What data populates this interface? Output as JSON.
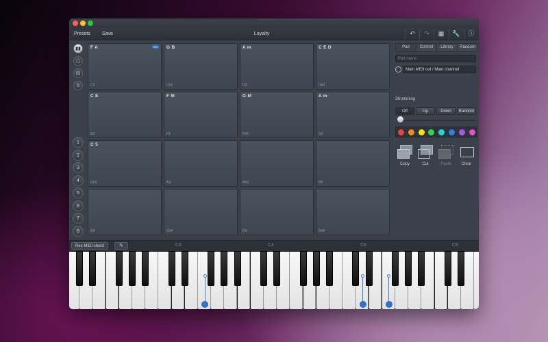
{
  "window": {
    "title": "Loyalty",
    "traffic_lights": {
      "close": "#ff5f57",
      "minimize": "#febc2e",
      "zoom": "#28c840"
    }
  },
  "toolbar": {
    "presets_label": "Presets",
    "save_label": "Save",
    "icons": [
      "undo-icon",
      "redo-icon",
      "grid-icon",
      "wrench-icon",
      "info-icon"
    ]
  },
  "modes": [
    "piano-icon",
    "pad-icon",
    "sheet-icon",
    "sort-icon"
  ],
  "banks": [
    "1",
    "2",
    "3",
    "4",
    "5",
    "6",
    "7",
    "8"
  ],
  "pads": [
    {
      "chord": "F A",
      "note": "C3",
      "active": true
    },
    {
      "chord": "G B",
      "note": "C#3"
    },
    {
      "chord": "A m",
      "note": "D3"
    },
    {
      "chord": "C E D",
      "note": "D#3"
    },
    {
      "chord": "C E",
      "note": "E3"
    },
    {
      "chord": "F M",
      "note": "F3"
    },
    {
      "chord": "G M",
      "note": "F#3"
    },
    {
      "chord": "A m",
      "note": "G3"
    },
    {
      "chord": "C 5",
      "note": "G#3"
    },
    {
      "chord": "",
      "note": "A3"
    },
    {
      "chord": "",
      "note": "A#3"
    },
    {
      "chord": "",
      "note": "B3"
    },
    {
      "chord": "",
      "note": "C4"
    },
    {
      "chord": "",
      "note": "C#4"
    },
    {
      "chord": "",
      "note": "D4"
    },
    {
      "chord": "",
      "note": "D#4"
    }
  ],
  "panel": {
    "tabs": [
      "Pad",
      "Control",
      "Library",
      "Random"
    ],
    "selected_tab": "Pad",
    "pad_name_placeholder": "Pad name",
    "midi_output": "Main MIDI out / Main channel",
    "strumming_label": "Strumming",
    "strum_options": [
      "Off",
      "Up",
      "Down",
      "Random"
    ],
    "strum_selected": "Off",
    "strum_amount": 0,
    "colors": [
      "#e8433f",
      "#f08a24",
      "#f3e21b",
      "#2fd64a",
      "#20d8d0",
      "#2f7fe0",
      "#a45be0",
      "#e04fd0"
    ],
    "actions": [
      {
        "label": "Copy",
        "icon": "copy-icon",
        "enabled": true
      },
      {
        "label": "Cut",
        "icon": "cut-icon",
        "enabled": true
      },
      {
        "label": "Paste",
        "icon": "paste-icon",
        "enabled": false
      },
      {
        "label": "Clear",
        "icon": "clear-icon",
        "enabled": true
      }
    ]
  },
  "piano": {
    "rec_label": "Rec MIDI chord",
    "pencil_icon": "pencil-icon",
    "octave_labels": [
      "C3",
      "C4",
      "C5",
      "C6"
    ],
    "highlighted_notes": [
      "F3",
      "D5",
      "F5"
    ]
  }
}
